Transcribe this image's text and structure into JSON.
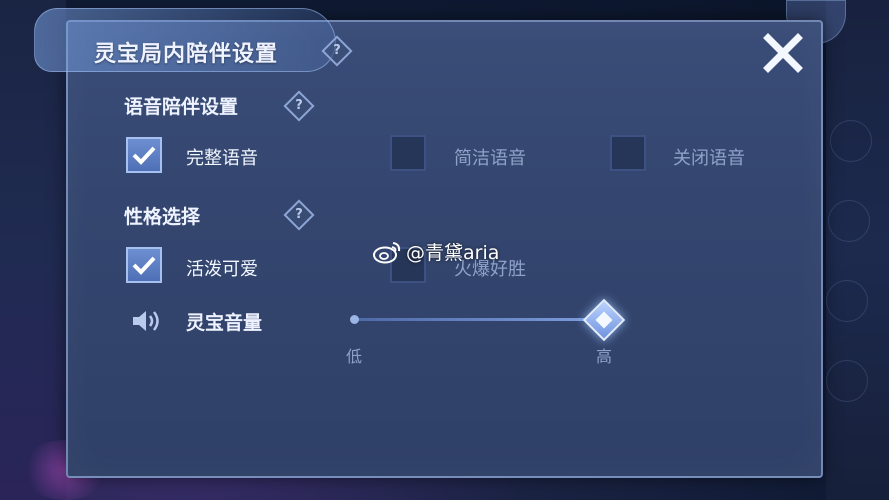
{
  "panel": {
    "title": "灵宝局内陪伴设置"
  },
  "voice_section": {
    "label": "语音陪伴设置",
    "options": [
      {
        "label": "完整语音",
        "checked": true
      },
      {
        "label": "简洁语音",
        "checked": false
      },
      {
        "label": "关闭语音",
        "checked": false
      }
    ]
  },
  "personality_section": {
    "label": "性格选择",
    "options": [
      {
        "label": "活泼可爱",
        "checked": true
      },
      {
        "label": "火爆好胜",
        "checked": false
      }
    ]
  },
  "volume": {
    "label": "灵宝音量",
    "min_label": "低",
    "max_label": "高",
    "level": 1.0
  },
  "watermark": {
    "text": "@青黛aria"
  },
  "colors": {
    "accent": "#6d8fd1",
    "panel_bg": "#34466f",
    "text_primary": "#eef3ff",
    "text_disabled": "#8ea2c8"
  }
}
